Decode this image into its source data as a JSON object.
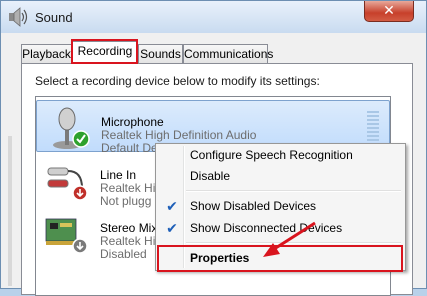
{
  "window": {
    "title": "Sound",
    "close_glyph": "✕"
  },
  "tabs": [
    {
      "label": "Playback"
    },
    {
      "label": "Recording"
    },
    {
      "label": "Sounds"
    },
    {
      "label": "Communications"
    }
  ],
  "active_tab": "Recording",
  "instruction": "Select a recording device below to modify its settings:",
  "devices": [
    {
      "name": "Microphone",
      "line1": "Realtek High Definition Audio",
      "line2": "Default Device",
      "status_icon": "green-check-icon"
    },
    {
      "name": "Line In",
      "line1": "Realtek Hig",
      "line2": "Not plugg",
      "status_icon": "red-down-arrow-icon"
    },
    {
      "name": "Stereo Mix",
      "line1": "Realtek Hig",
      "line2": "Disabled",
      "status_icon": "grey-down-arrow-icon"
    }
  ],
  "context_menu": {
    "items": [
      {
        "label": "Configure Speech Recognition",
        "checked": false
      },
      {
        "label": "Disable",
        "checked": false
      },
      {
        "label": "Show Disabled Devices",
        "checked": true
      },
      {
        "label": "Show Disconnected Devices",
        "checked": true
      },
      {
        "label": "Properties",
        "checked": false,
        "bold": true
      }
    ]
  },
  "colors": {
    "highlight": "#d9141e",
    "selection": "#c1dcfc",
    "check": "#1e5fb8"
  }
}
